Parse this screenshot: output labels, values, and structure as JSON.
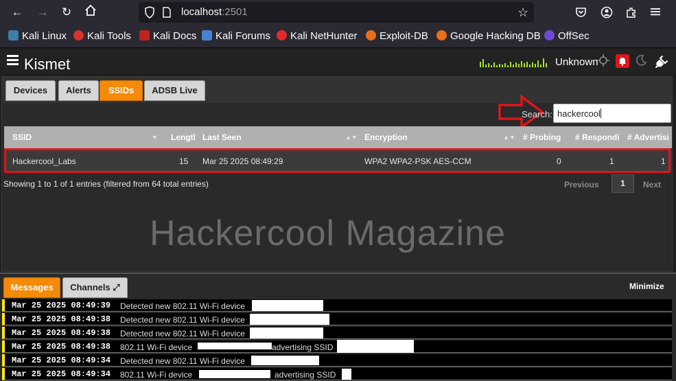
{
  "browser": {
    "url_host": "localhost",
    "url_port": ":2501",
    "bookmarks": [
      "Kali Linux",
      "Kali Tools",
      "Kali Docs",
      "Kali Forums",
      "Kali NetHunter",
      "Exploit-DB",
      "Google Hacking DB",
      "OffSec"
    ]
  },
  "app": {
    "title": "Kismet",
    "status": "Unknown",
    "tabs": [
      "Devices",
      "Alerts",
      "SSIDs",
      "ADSB Live"
    ],
    "active_tab": "SSIDs"
  },
  "search": {
    "label": "Search:",
    "value": "hackercool"
  },
  "table": {
    "columns": [
      "SSID",
      "Lengtl",
      "Last Seen",
      "Encryption",
      "# Probing",
      "# Respondi",
      "# Advertisi"
    ],
    "rows": [
      {
        "ssid": "Hackercool_Labs",
        "length": "15",
        "last_seen": "Mar 25 2025 08:49:29",
        "encryption": "WPA2 WPA2-PSK AES-CCM",
        "probing": "0",
        "responding": "1",
        "advertising": "1"
      }
    ],
    "info": "Showing 1 to 1 of 1 entries (filtered from 64 total entries)",
    "pagination": {
      "previous": "Previous",
      "current": "1",
      "next": "Next"
    }
  },
  "watermark": "Hackercool Magazine",
  "messages_panel": {
    "tabs": [
      "Messages",
      "Channels"
    ],
    "minimize": "Minimize",
    "messages": [
      {
        "time": "Mar 25 2025 08:49:39",
        "text": "Detected new 802.11 Wi-Fi device"
      },
      {
        "time": "Mar 25 2025 08:49:38",
        "text": "Detected new 802.11 Wi-Fi device"
      },
      {
        "time": "Mar 25 2025 08:49:38",
        "text": "Detected new 802.11 Wi-Fi device"
      },
      {
        "time": "Mar 25 2025 08:49:38",
        "text": "802.11 Wi-Fi device",
        "suffix": "advertising SSID"
      },
      {
        "time": "Mar 25 2025 08:49:34",
        "text": "Detected new 802.11 Wi-Fi device"
      },
      {
        "time": "Mar 25 2025 08:49:34",
        "text": "802.11 Wi-Fi device",
        "suffix": "advertising SSID"
      }
    ]
  },
  "colors": {
    "accent": "#f58a07",
    "highlight": "#e0141b",
    "message_marker": "#ffec00"
  }
}
